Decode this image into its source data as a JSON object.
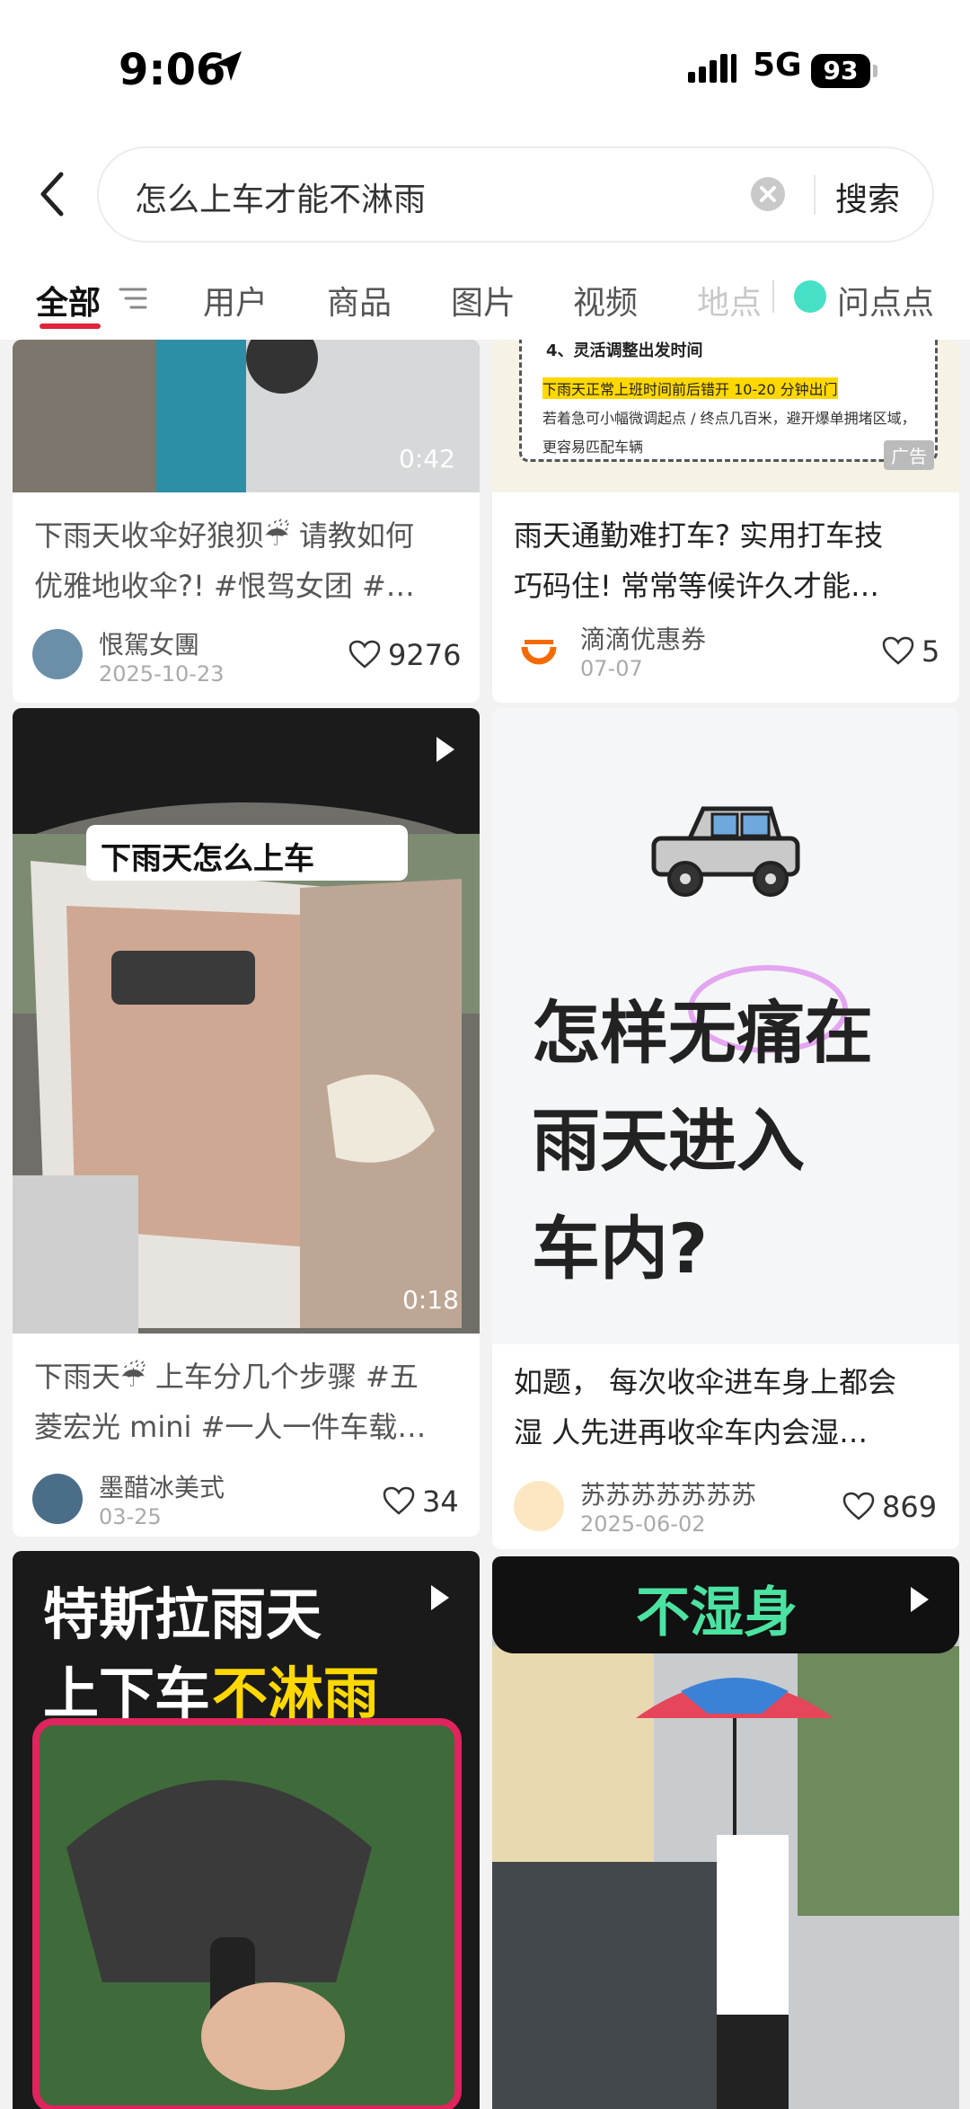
{
  "status": {
    "time": "9:06",
    "network": "5G",
    "battery": "93"
  },
  "search": {
    "query": "怎么上车才能不淋雨",
    "button": "搜索"
  },
  "tabs": [
    {
      "label": "全部",
      "active": true
    },
    {
      "label": "用户"
    },
    {
      "label": "商品"
    },
    {
      "label": "图片"
    },
    {
      "label": "视频"
    },
    {
      "label": "地点"
    },
    {
      "label": "问点点"
    }
  ],
  "cards": [
    {
      "title_line1": "下雨天收伞好狼狈☔ 请教如何",
      "title_line2": "优雅地收伞?! #恨驾女团 #…",
      "author": "恨駕女團",
      "date": "2025-10-23",
      "likes": "9276",
      "duration": "0:42"
    },
    {
      "title_line1": "雨天通勤难打车? 实用打车技",
      "title_line2": "巧码住! 常常等候许久才能…",
      "author": "滴滴优惠券",
      "date": "07-07",
      "likes": "5",
      "ad": "广告",
      "thumb_line1": "4、灵活调整出发时间",
      "thumb_line2": "下雨天正常上班时间前后错开 10-20 分钟出门",
      "thumb_line3": "若着急可小幅微调起点 / 终点几百米，避开爆单拥堵区域，",
      "thumb_line4": "更容易匹配车辆"
    },
    {
      "title_line1": "下雨天☔ 上车分几个步骤 #五",
      "title_line2": "菱宏光 mini #一人一件车载…",
      "author": "墨醋冰美式",
      "date": "03-25",
      "likes": "34",
      "duration": "0:18",
      "overlay": "下雨天怎么上车"
    },
    {
      "title_line1": "如题， 每次收伞进车身上都会",
      "title_line2": "湿 人先进再收伞车内会湿…",
      "author": "苏苏苏苏苏苏苏",
      "date": "2025-06-02",
      "likes": "869",
      "big_line1": "怎样无痛在",
      "big_line2": "雨天进入",
      "big_line3": "车内?"
    },
    {
      "overlay_line1": "特斯拉雨天",
      "overlay_line2a": "上下车",
      "overlay_line2b": "不淋雨"
    },
    {
      "overlay_line1": "不湿身"
    }
  ],
  "colors": {
    "accent": "#e0243d",
    "didi": "#f56a00",
    "highlight": "#ffd800"
  }
}
